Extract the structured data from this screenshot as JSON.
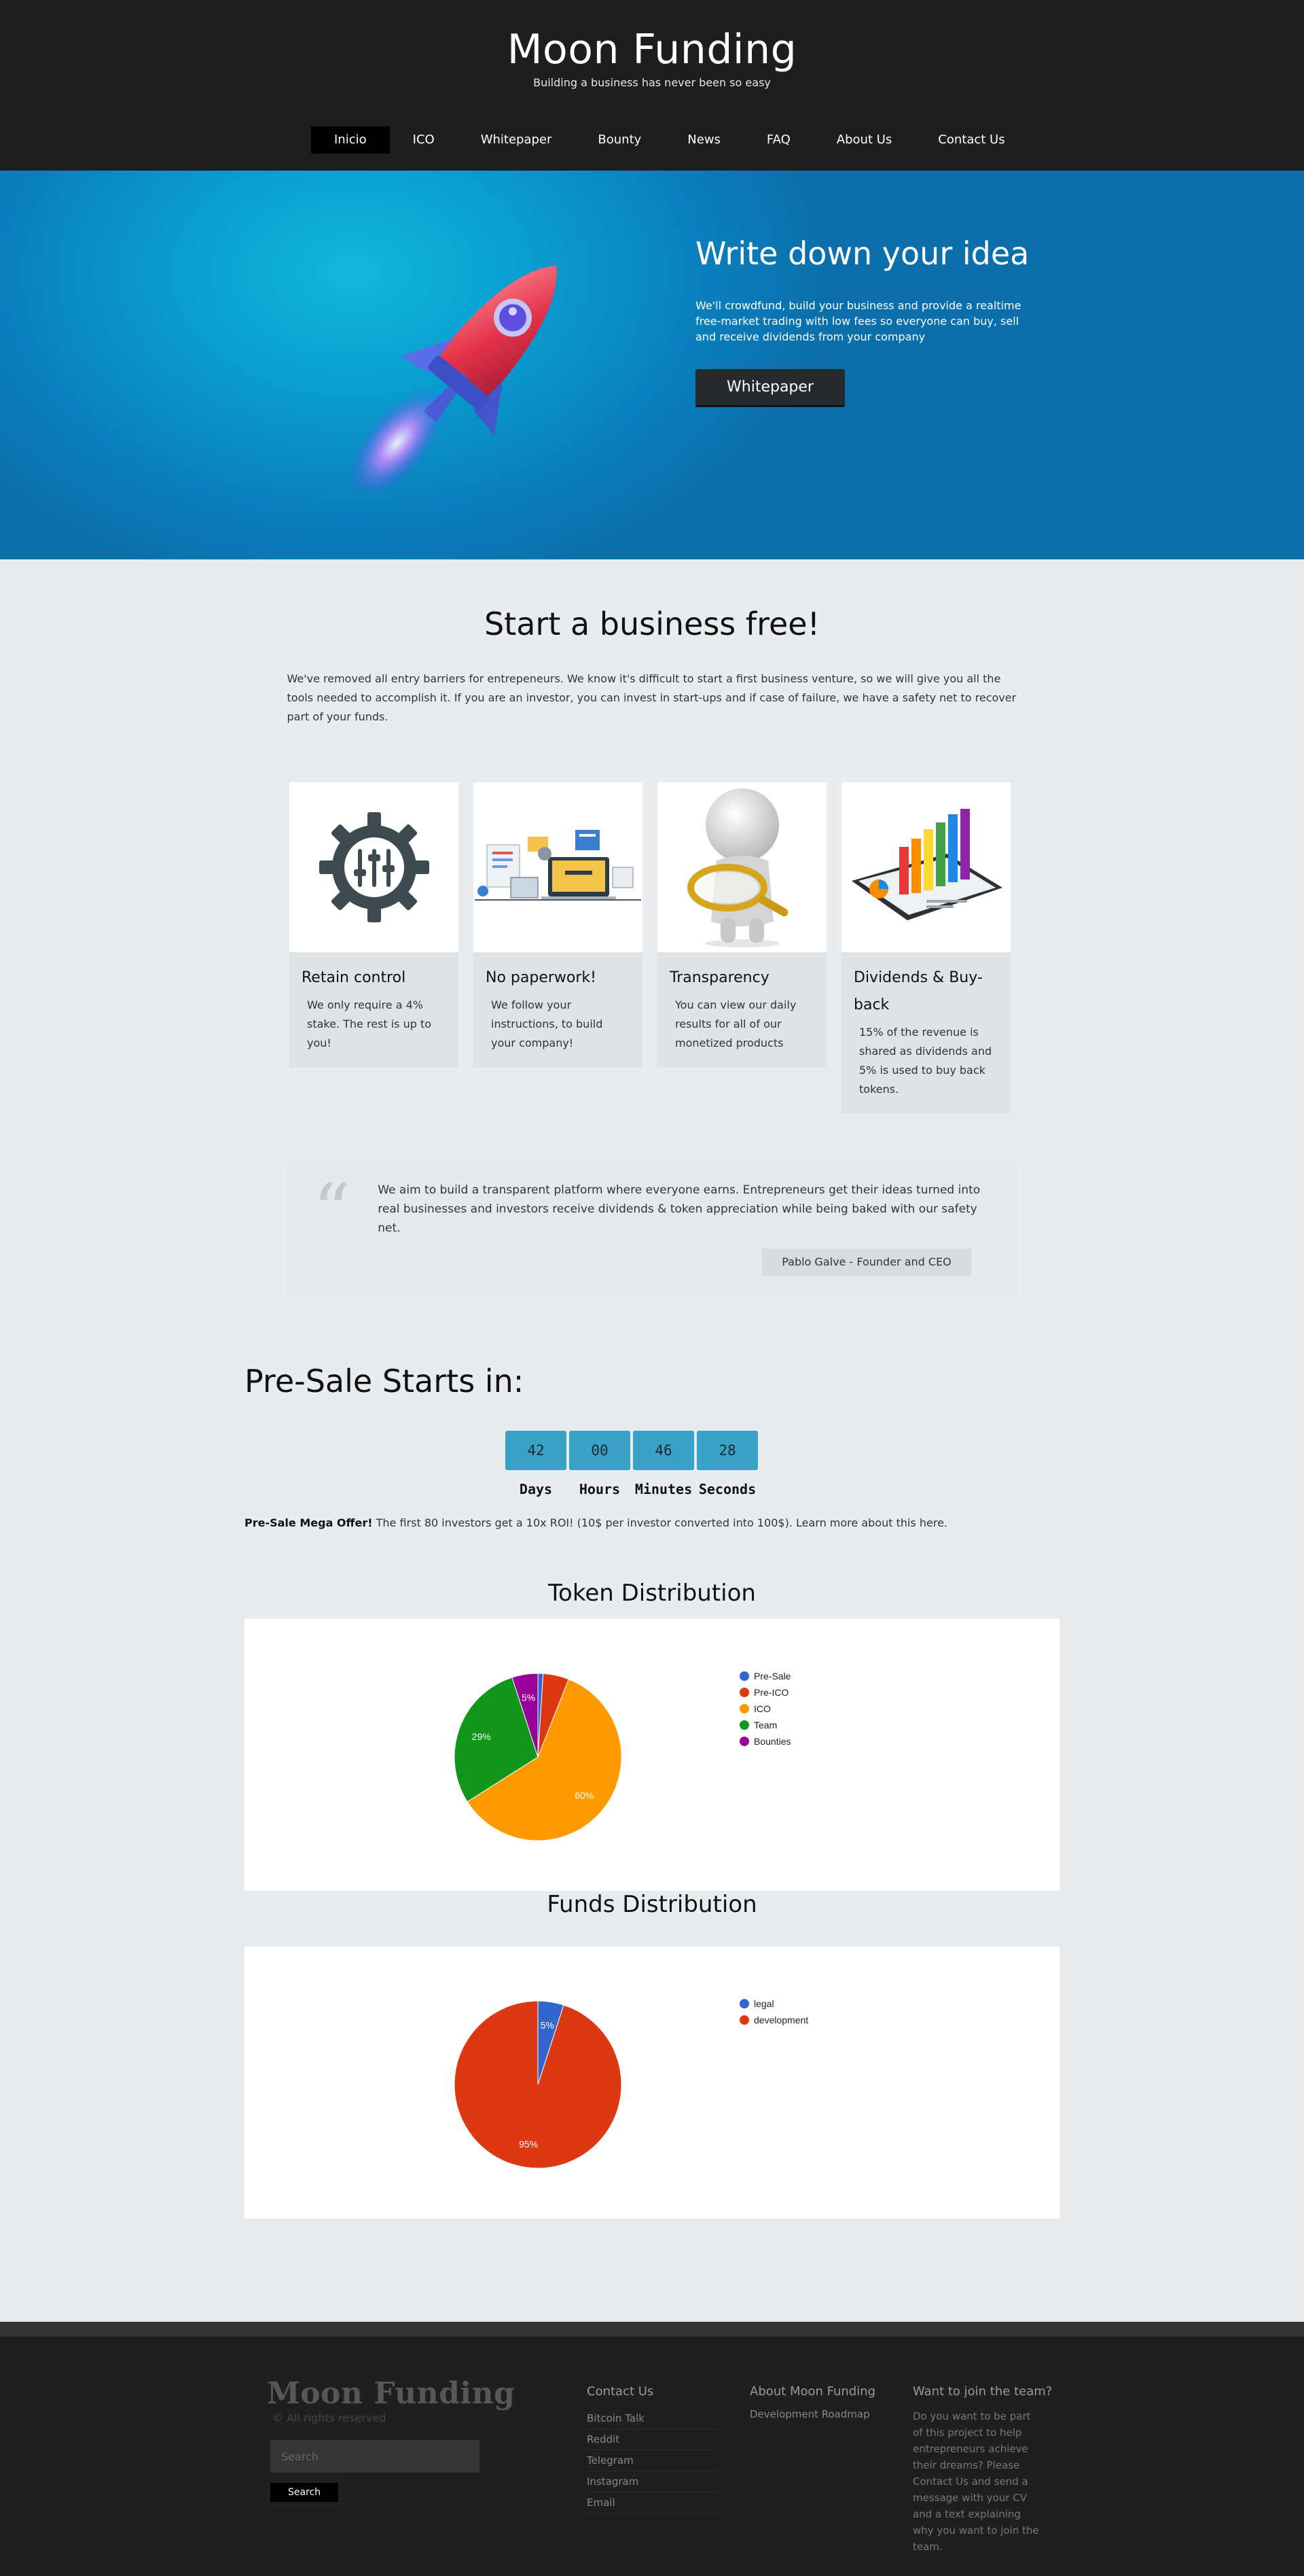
{
  "header": {
    "title": "Moon Funding",
    "tagline": "Building a business has never been so easy"
  },
  "nav": [
    "Inicio",
    "ICO",
    "Whitepaper",
    "Bounty",
    "News",
    "FAQ",
    "About Us",
    "Contact Us"
  ],
  "hero": {
    "title": "Write down your idea",
    "description": "We'll crowdfund, build your business and provide a realtime free-market trading with low fees so everyone can buy, sell and receive dividends from your company",
    "button": "Whitepaper"
  },
  "intro": {
    "title": "Start a business free!",
    "description": "We've removed all entry barriers for entrepeneurs. We know it's difficult to start a first business venture, so we will give you all the tools needed to accomplish it. If you are an investor, you can invest in start-ups and if case of failure, we have a safety net to recover part of your funds."
  },
  "features": [
    {
      "title": "Retain control",
      "text": "We only require a 4% stake. The rest is up to you!"
    },
    {
      "title": "No paperwork!",
      "text": "We follow your instructions, to build your company!"
    },
    {
      "title": "Transparency",
      "text": "You can view our daily results for all of our monetized products"
    },
    {
      "title": "Dividends & Buy-back",
      "text": "15% of the revenue is shared as dividends and 5% is used to buy back tokens."
    }
  ],
  "quote": {
    "text": "We aim to build a transparent platform where everyone earns. Entrepreneurs get their ideas turned into real businesses and investors receive dividends & token appreciation while being baked with our safety net.",
    "author": "Pablo Galve - Founder and CEO"
  },
  "presale": {
    "title": "Pre-Sale Starts in:",
    "countdown": [
      {
        "value": "42",
        "label": "Days"
      },
      {
        "value": "00",
        "label": "Hours"
      },
      {
        "value": "46",
        "label": "Minutes"
      },
      {
        "value": "28",
        "label": "Seconds"
      }
    ],
    "offer_bold": "Pre-Sale Mega Offer!",
    "offer_text": " The first 80 investors get a 10x ROI! (10$ per investor converted into 100$). Learn more about this here."
  },
  "chart_data": [
    {
      "type": "pie",
      "title": "Token Distribution",
      "categories": [
        "Pre-Sale",
        "Pre-ICO",
        "ICO",
        "Team",
        "Bounties"
      ],
      "values": [
        1,
        5,
        60,
        29,
        5
      ],
      "colors": [
        "#3366cc",
        "#dc3912",
        "#ff9900",
        "#109618",
        "#990099"
      ],
      "slice_labels": [
        "",
        "",
        "60%",
        "29%",
        "5%"
      ],
      "legend": "right"
    },
    {
      "type": "pie",
      "title": "Funds Distribution",
      "categories": [
        "legal",
        "development"
      ],
      "values": [
        5,
        95
      ],
      "colors": [
        "#3366cc",
        "#dc3912"
      ],
      "slice_labels": [
        "5%",
        "95%"
      ],
      "legend": "right"
    }
  ],
  "footer": {
    "logo": "Moon Funding",
    "rights": "© All rights reserved",
    "search_placeholder": "Search",
    "search_button": "Search",
    "contact_title": "Contact Us",
    "contact_links": [
      "Bitcoin Talk",
      "Reddit",
      "Telegram",
      "Instagram",
      "Email"
    ],
    "about_title": "About Moon Funding",
    "about_links": [
      "Development Roadmap"
    ],
    "join_title": "Want to join the team?",
    "join_text": "Do you want to be part of this project to help entrepreneurs achieve their dreams? Please Contact Us and send a message with your CV and a text explaining why you want to join the team."
  }
}
